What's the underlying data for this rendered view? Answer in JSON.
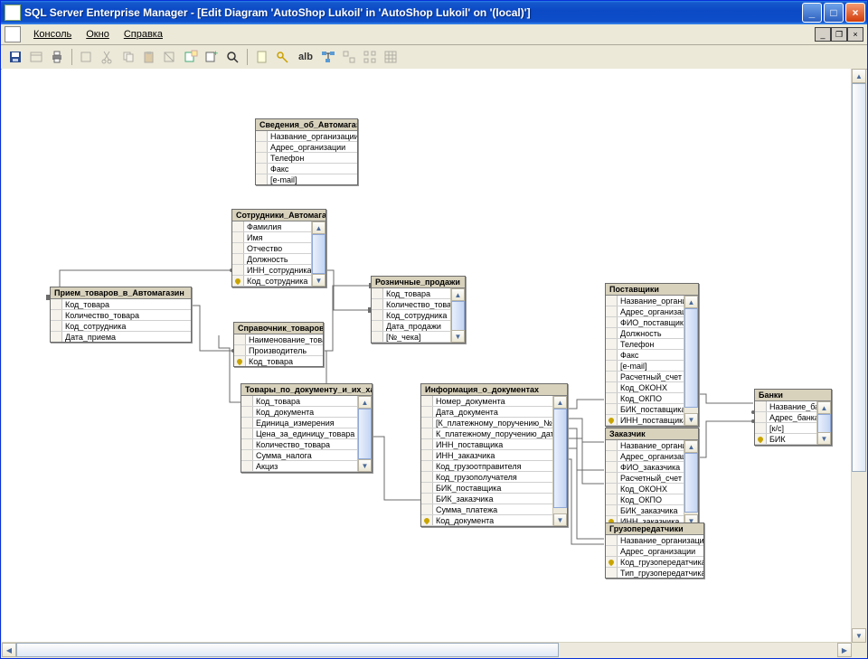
{
  "title": "SQL Server Enterprise Manager - [Edit Diagram 'AutoShop Lukoil' in 'AutoShop Lukoil' on '(local)']",
  "menu": {
    "console": "Консоль",
    "window": "Окно",
    "help": "Справка"
  },
  "toolbar": {
    "ab_label": "alb"
  },
  "tables": {
    "t1": {
      "name": "Сведения_об_Автомагаз",
      "cols": [
        "Название_организации",
        "Адрес_организации",
        "Телефон",
        "Факс",
        "[e-mail]"
      ],
      "pk": []
    },
    "t2": {
      "name": "Сотрудники_Автомагазина",
      "cols": [
        "Фамилия",
        "Имя",
        "Отчество",
        "Должность",
        "ИНН_сотрудника",
        "Код_сотрудника"
      ],
      "pk": [
        5
      ]
    },
    "t3": {
      "name": "Прием_товаров_в_Автомагазин",
      "cols": [
        "Код_товара",
        "Количество_товара",
        "Код_сотрудника",
        "Дата_приема"
      ],
      "pk": []
    },
    "t4": {
      "name": "Справочник_товаров",
      "cols": [
        "Наименование_товара",
        "Производитель",
        "Код_товара"
      ],
      "pk": [
        2
      ]
    },
    "t5": {
      "name": "Розничные_продажи",
      "cols": [
        "Код_товара",
        "Количество_товара",
        "Код_сотрудника",
        "Дата_продажи",
        "[№_чека]"
      ],
      "pk": []
    },
    "t6": {
      "name": "Товары_по_документу_и_их_хар",
      "cols": [
        "Код_товара",
        "Код_документа",
        "Единица_измерения",
        "Цена_за_единицу_товара",
        "Количество_товара",
        "Сумма_налога",
        "Акциз"
      ],
      "pk": []
    },
    "t7": {
      "name": "Информация_о_документах",
      "cols": [
        "Номер_документа",
        "Дата_документа",
        "[К_платежному_поручению_№]",
        "К_платежному_поручению_дата",
        "ИНН_поставщика",
        "ИНН_заказчика",
        "Код_грузоотправителя",
        "Код_грузополучателя",
        "БИК_поставщика",
        "БИК_заказчика",
        "Сумма_платежа",
        "Код_документа"
      ],
      "pk": [
        11
      ]
    },
    "t8": {
      "name": "Поставщики",
      "cols": [
        "Название_организации",
        "Адрес_организации",
        "ФИО_поставщика",
        "Должность",
        "Телефон",
        "Факс",
        "[e-mail]",
        "Расчетный_счет",
        "Код_ОКОНХ",
        "Код_ОКПО",
        "БИК_поставщика",
        "ИНН_поставщика"
      ],
      "pk": [
        11
      ]
    },
    "t9": {
      "name": "Заказчик",
      "cols": [
        "Название_организации",
        "Адрес_организации",
        "ФИО_заказчика",
        "Расчетный_счет",
        "Код_ОКОНХ",
        "Код_ОКПО",
        "БИК_заказчика",
        "ИНН_заказчика"
      ],
      "pk": [
        7
      ]
    },
    "t10": {
      "name": "Банки",
      "cols": [
        "Название_банка",
        "Адрес_банка",
        "[к/с]",
        "БИК"
      ],
      "pk": [
        3
      ]
    },
    "t11": {
      "name": "Грузопередатчики",
      "cols": [
        "Название_организации",
        "Адрес_организации",
        "Код_грузопередатчика",
        "Тип_грузопередатчика"
      ],
      "pk": [
        2
      ]
    }
  }
}
